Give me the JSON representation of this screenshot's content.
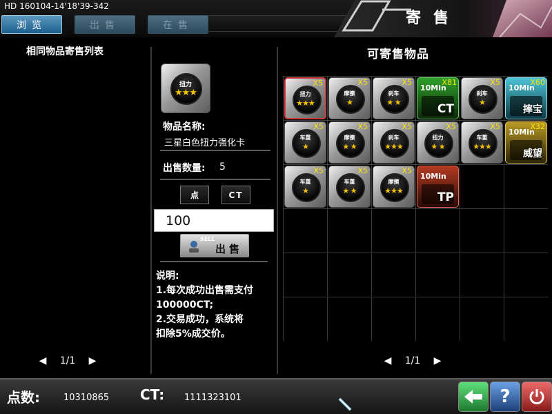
{
  "build_label": "HD 160104-14'18'39-342",
  "header_title": "寄售",
  "tabs": [
    {
      "label": "浏览",
      "active": true
    },
    {
      "label": "出售",
      "active": false
    },
    {
      "label": "在售",
      "active": false
    }
  ],
  "left_panel": {
    "title": "相同物品寄售列表",
    "pager": {
      "text": "1/1"
    }
  },
  "detail": {
    "icon_label": "扭力",
    "icon_stars": "★★★",
    "name_label": "物品名称:",
    "name_value": "三星白色扭力强化卡",
    "qty_label": "出售数量:",
    "qty_value": "5",
    "currency_point": "点",
    "currency_ct": "CT",
    "price_value": "100",
    "sell_small": "SELL",
    "sell_label": "出售",
    "description": "说明:\n1.每次成功出售需支付\n100000CT;\n2.交易成功，系统将\n扣除5%成交价。"
  },
  "right_panel": {
    "title": "可寄售物品",
    "pager": {
      "text": "1/1"
    },
    "items": [
      {
        "kind": "part",
        "name": "扭力",
        "stars": "★★★",
        "qty": "X5",
        "selected": true
      },
      {
        "kind": "part",
        "name": "摩擦",
        "stars": "★",
        "qty": "X5"
      },
      {
        "kind": "part",
        "name": "刹车",
        "stars": "★ ★",
        "qty": "X5"
      },
      {
        "kind": "card",
        "color": "green",
        "top": "10Min",
        "big": "CT",
        "qty": "X81"
      },
      {
        "kind": "part",
        "name": "刹车",
        "stars": "★",
        "qty": "X5"
      },
      {
        "kind": "card",
        "color": "cyan",
        "top": "10Min",
        "big": "摔宝",
        "qty": "X60"
      },
      {
        "kind": "part",
        "name": "车重",
        "stars": "★",
        "qty": "X5"
      },
      {
        "kind": "part",
        "name": "摩擦",
        "stars": "★ ★",
        "qty": "X5"
      },
      {
        "kind": "part",
        "name": "刹车",
        "stars": "★★★",
        "qty": "X5"
      },
      {
        "kind": "part",
        "name": "扭力",
        "stars": "★ ★",
        "qty": "X5"
      },
      {
        "kind": "part",
        "name": "车重",
        "stars": "★★★",
        "qty": "X5"
      },
      {
        "kind": "card",
        "color": "gold",
        "top": "10Min",
        "big": "威望",
        "qty": "X32"
      },
      {
        "kind": "part",
        "name": "车重",
        "stars": "★",
        "qty": "X5"
      },
      {
        "kind": "part",
        "name": "车重",
        "stars": "★ ★",
        "qty": "X5"
      },
      {
        "kind": "part",
        "name": "摩擦",
        "stars": "★★★",
        "qty": "X5"
      },
      {
        "kind": "card",
        "color": "red",
        "top": "10Min",
        "big": "TP",
        "qty": ""
      }
    ]
  },
  "footer": {
    "points_label": "点数:",
    "points_value": "10310865",
    "ct_label": "CT:",
    "ct_value": "1111323101"
  },
  "icons": [
    "back-arrow-icon",
    "help-icon",
    "power-icon"
  ]
}
